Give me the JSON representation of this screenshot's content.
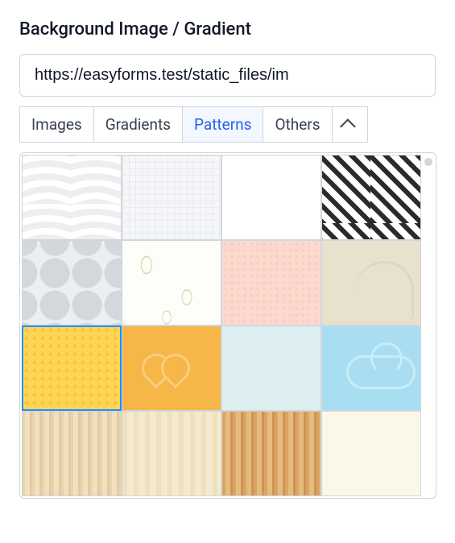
{
  "section": {
    "title": "Background Image / Gradient"
  },
  "input": {
    "value": "https://easyforms.test/static_files/im"
  },
  "tabs": {
    "items": [
      {
        "label": "Images",
        "active": false
      },
      {
        "label": "Gradients",
        "active": false
      },
      {
        "label": "Patterns",
        "active": true
      },
      {
        "label": "Others",
        "active": false
      }
    ],
    "collapse_icon": "chevron-up"
  },
  "patterns": {
    "selected_index": 8,
    "thumbs": [
      {
        "name": "waves-light",
        "css": "p-waves"
      },
      {
        "name": "subtle-grid",
        "css": "p-subtlegrid"
      },
      {
        "name": "plain-white",
        "css": "p-white"
      },
      {
        "name": "diagonal-stripes",
        "css": "p-diagonal"
      },
      {
        "name": "grey-quatrefoil",
        "css": "p-quatrefoil"
      },
      {
        "name": "green-leaves",
        "css": "p-leaves"
      },
      {
        "name": "peach-dots",
        "css": "p-peachdots"
      },
      {
        "name": "beige-stroller",
        "css": "p-stroller"
      },
      {
        "name": "yellow-dot-grid",
        "css": "p-yellowgrid"
      },
      {
        "name": "orange-heart",
        "css": "p-heart"
      },
      {
        "name": "pale-blue",
        "css": "p-paleblue"
      },
      {
        "name": "sky-cloud",
        "css": "p-cloud"
      },
      {
        "name": "light-wood-1",
        "css": "p-wood1"
      },
      {
        "name": "light-wood-2",
        "css": "p-wood2"
      },
      {
        "name": "medium-wood",
        "css": "p-wood3"
      },
      {
        "name": "cream-plain",
        "css": "p-cream"
      }
    ]
  }
}
